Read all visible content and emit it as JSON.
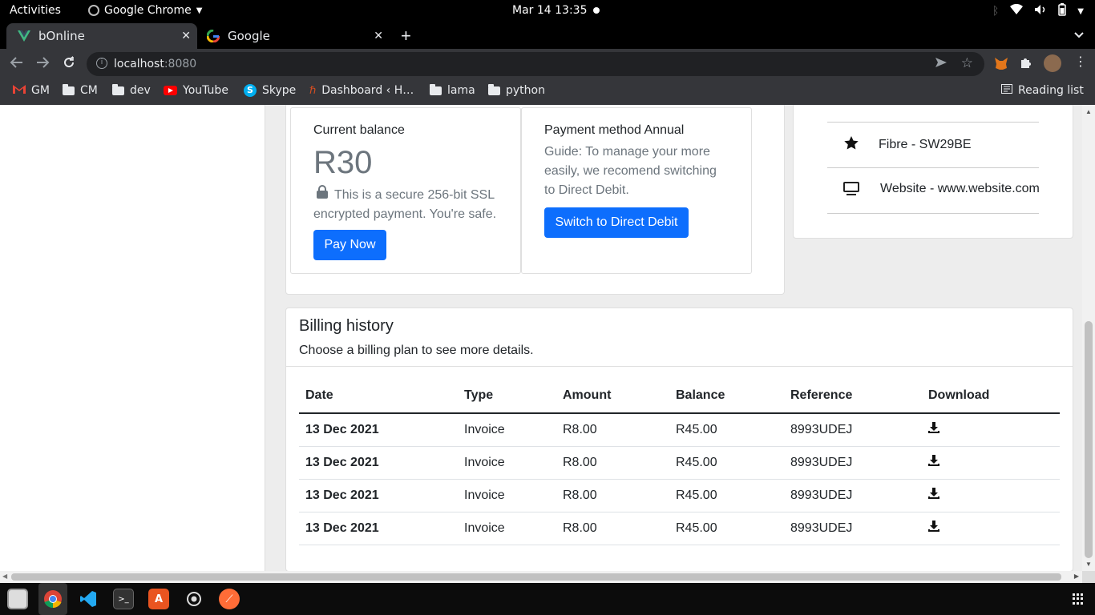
{
  "system_bar": {
    "activities": "Activities",
    "app_name": "Google Chrome",
    "datetime": "Mar 14  13:35"
  },
  "tabs": [
    {
      "title": "bOnline",
      "icon": "vue-icon",
      "active": true
    },
    {
      "title": "Google",
      "icon": "google-icon",
      "active": false
    }
  ],
  "address_bar": {
    "host": "localhost",
    "port": ":8080"
  },
  "bookmarks": [
    {
      "label": "GM",
      "icon": "gmail-icon"
    },
    {
      "label": "CM",
      "icon": "folder-icon"
    },
    {
      "label": "dev",
      "icon": "folder-icon"
    },
    {
      "label": "YouTube",
      "icon": "youtube-icon"
    },
    {
      "label": "Skype",
      "icon": "skype-icon"
    },
    {
      "label": "Dashboard ‹ H…",
      "icon": "wordpress-icon"
    },
    {
      "label": "lama",
      "icon": "folder-icon"
    },
    {
      "label": "python",
      "icon": "folder-icon"
    }
  ],
  "reading_list": "Reading list",
  "balance_card": {
    "title": "Current balance",
    "amount": "R30",
    "secure_text": "This is a secure 256-bit SSL encrypted payment. You're safe.",
    "pay_button": "Pay Now"
  },
  "payment_card": {
    "title": "Payment method Annual",
    "guide": "Guide: To manage your more easily, we recomend switching to Direct Debit.",
    "button": "Switch to Direct Debit"
  },
  "services": [
    {
      "label": "Fibre - SW29BE",
      "icon": "star-icon"
    },
    {
      "label": "Website - www.website.com",
      "icon": "monitor-icon"
    }
  ],
  "billing": {
    "title": "Billing history",
    "subtitle": "Choose a billing plan to see more details.",
    "columns": [
      "Date",
      "Type",
      "Amount",
      "Balance",
      "Reference",
      "Download"
    ],
    "rows": [
      {
        "date": "13 Dec 2021",
        "type": "Invoice",
        "amount": "R8.00",
        "balance": "R45.00",
        "reference": "8993UDEJ"
      },
      {
        "date": "13 Dec 2021",
        "type": "Invoice",
        "amount": "R8.00",
        "balance": "R45.00",
        "reference": "8993UDEJ"
      },
      {
        "date": "13 Dec 2021",
        "type": "Invoice",
        "amount": "R8.00",
        "balance": "R45.00",
        "reference": "8993UDEJ"
      },
      {
        "date": "13 Dec 2021",
        "type": "Invoice",
        "amount": "R8.00",
        "balance": "R45.00",
        "reference": "8993UDEJ"
      }
    ]
  },
  "colors": {
    "primary": "#0d6efd",
    "muted": "#6c757d",
    "page_bg": "#ededed"
  }
}
